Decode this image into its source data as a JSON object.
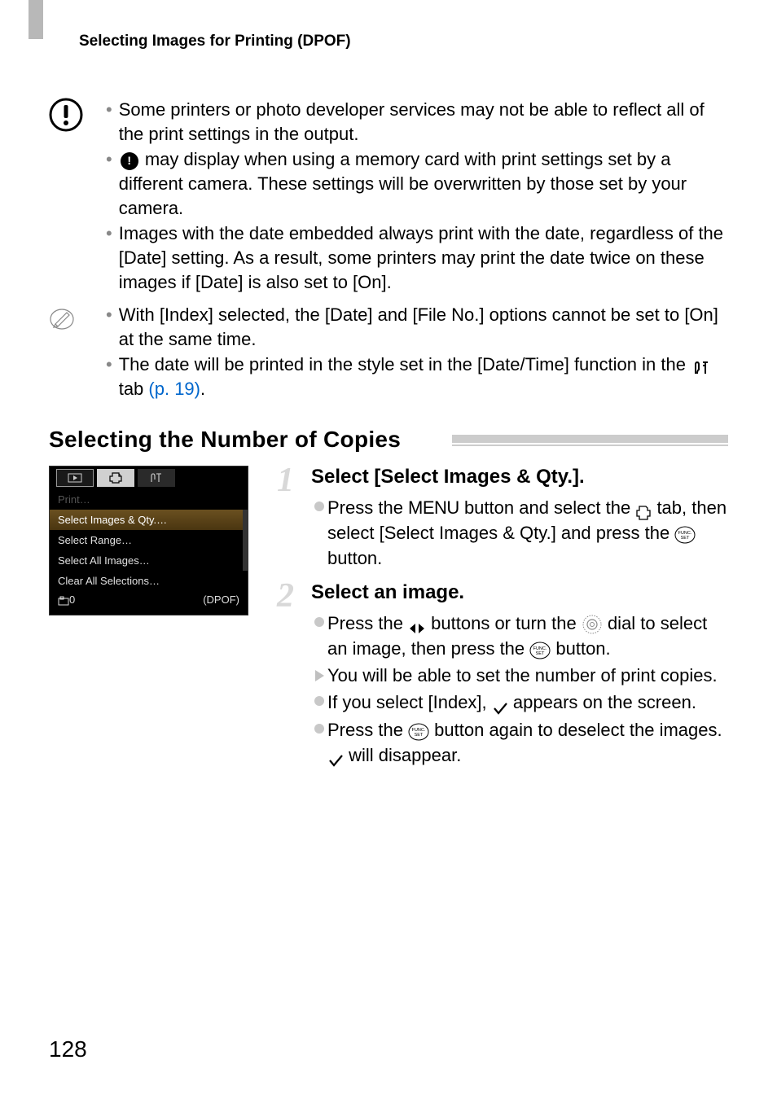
{
  "header": {
    "title": "Selecting Images for Printing (DPOF)"
  },
  "alert_notes": {
    "item1": "Some printers or photo developer services may not be able to reflect all of the print settings in the output.",
    "item2_after_icon": " may display when using a memory card with print settings set by a different camera. These settings will be overwritten by those set by your camera.",
    "item3": "Images with the date embedded always print with the date, regardless of the [Date] setting. As a result, some printers may print the date twice on these images if [Date] is also set to [On]."
  },
  "pencil_notes": {
    "item1": "With [Index] selected, the [Date] and [File No.] options cannot be set to [On] at the same time.",
    "item2_prefix": "The date will be printed in the style set in the [Date/Time] function in the ",
    "item2_tab": " tab ",
    "item2_link": "(p. 19)",
    "item2_end": "."
  },
  "section": {
    "heading": "Selecting the Number of Copies"
  },
  "camera_menu": {
    "row0": "Print…",
    "row1": "Select Images & Qty.…",
    "row2": "Select Range…",
    "row3": "Select All Images…",
    "row4": "Clear All Selections…",
    "icon_label": "0",
    "corner": "(DPOF)"
  },
  "step1": {
    "title": "Select [Select Images & Qty.].",
    "line1_a": "Press the ",
    "line1_menu": "MENU",
    "line1_b": " button and select the ",
    "line1_c": " tab, then select [Select Images & Qty.] and press the ",
    "line1_d": " button."
  },
  "step2": {
    "title": "Select an image.",
    "line1_a": "Press the ",
    "line1_b": " buttons or turn the ",
    "line1_c": " dial to select an image, then press the ",
    "line1_d": " button.",
    "line2": "You will be able to set the number of print copies.",
    "line3_a": "If you select [Index], ",
    "line3_b": " appears on the screen.",
    "line4_a": "Press the ",
    "line4_b": " button again to deselect the images. ",
    "line4_c": " will disappear."
  },
  "page": "128"
}
